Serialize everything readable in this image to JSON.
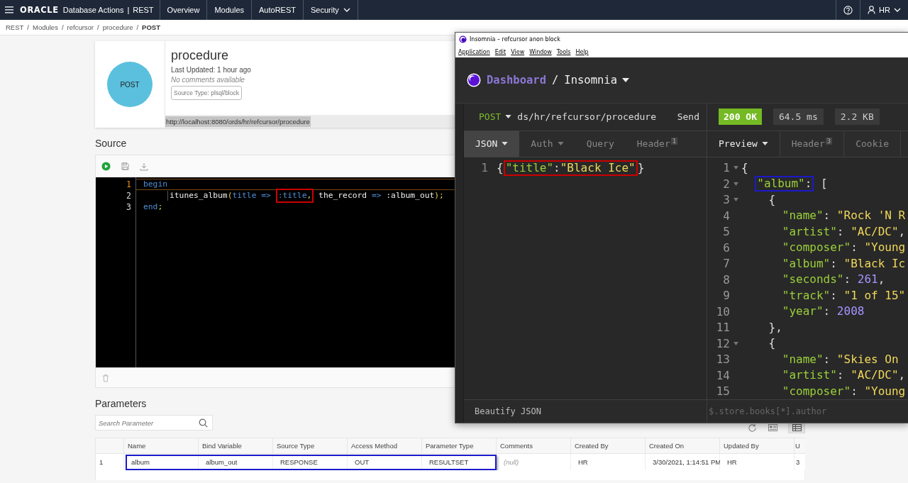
{
  "topbar": {
    "brand": "ORACLE",
    "product": "Database Actions",
    "divider": "|",
    "section": "REST",
    "user": "HR",
    "nav": [
      {
        "label": "Overview",
        "selected": false,
        "menu": false
      },
      {
        "label": "Modules",
        "selected": false,
        "menu": false
      },
      {
        "label": "AutoREST",
        "selected": false,
        "menu": false
      },
      {
        "label": "Security",
        "selected": false,
        "menu": true
      }
    ]
  },
  "breadcrumb": [
    {
      "label": "REST",
      "current": false
    },
    {
      "separator": "/",
      "label": "Modules",
      "current": false
    },
    {
      "separator": "/",
      "label": "refcursor",
      "current": false
    },
    {
      "separator": "/",
      "label": "procedure",
      "current": false
    },
    {
      "separator": "/",
      "label": "POST",
      "current": true
    }
  ],
  "handler": {
    "method": "POST",
    "title": "procedure",
    "updated": "Last Updated: 1 hour ago",
    "comments": "No comments available",
    "source_type": "Source Type: plsql/block",
    "url": "http://localhost:8080/ords/hr/refcursor/procedure"
  },
  "source": {
    "heading": "Source",
    "lines": [
      {
        "number": "1",
        "active": true,
        "tokens": [
          {
            "text": "begin",
            "kind": "keyword"
          }
        ]
      },
      {
        "number": "2",
        "active": false,
        "tokens": [
          {
            "text": "itunes_album",
            "kind": "ident"
          },
          {
            "text": "(",
            "kind": "paren"
          },
          {
            "text": "title =>",
            "kind": "keyword"
          },
          {
            "kind": "group",
            "color": "#cc0000",
            "gap": true,
            "parts": [
              {
                "text": ":title",
                "kind": "keyword"
              },
              {
                "text": ",",
                "kind": "paren"
              }
            ]
          },
          {
            "text": "the_record",
            "kind": "ident",
            "gap": true
          },
          {
            "text": "=>",
            "kind": "keyword",
            "gap": true
          },
          {
            "text": ":album_out",
            "kind": "ident",
            "gap": true
          },
          {
            "text": ");",
            "kind": "paren"
          }
        ]
      },
      {
        "number": "3",
        "active": false,
        "tokens": [
          {
            "text": "end",
            "kind": "keyword"
          },
          {
            "text": ";",
            "kind": "paren"
          }
        ]
      }
    ]
  },
  "parameters": {
    "heading": "Parameters",
    "search": {
      "placeholder": "Search Parameter"
    },
    "views": [
      {
        "kind": "card",
        "selected": false
      },
      {
        "kind": "table",
        "selected": true
      }
    ],
    "columns": [
      "Name",
      "Bind Variable",
      "Source Type",
      "Access Method",
      "Parameter Type",
      "Comments",
      "Created By",
      "Created On",
      "Updated By",
      "U"
    ],
    "rows": [
      {
        "index": "1",
        "color": "#1a1acc",
        "cells": [
          {
            "text": "album",
            "outlined": true,
            "muted": false
          },
          {
            "text": "album_out",
            "outlined": true,
            "muted": false
          },
          {
            "text": "RESPONSE",
            "outlined": true,
            "muted": false
          },
          {
            "text": "OUT",
            "outlined": true,
            "muted": false
          },
          {
            "text": "RESULTSET",
            "outlined": true,
            "muted": false
          },
          {
            "text": "(null)",
            "outlined": false,
            "muted": true
          },
          {
            "text": "HR",
            "outlined": false,
            "muted": false
          },
          {
            "text": "3/30/2021, 1:14:51 PM",
            "outlined": false,
            "muted": false
          },
          {
            "text": "HR",
            "outlined": false,
            "muted": false
          },
          {
            "text": "3",
            "outlined": false,
            "muted": false
          }
        ]
      }
    ]
  },
  "insomnia": {
    "window": {
      "title": "Insomnia – refcursor anon block"
    },
    "menu": [
      "Application",
      "Edit",
      "View",
      "Window",
      "Tools",
      "Help"
    ],
    "header": {
      "dashboard": "Dashboard",
      "separator": "/",
      "workspace": "Insomnia"
    },
    "request": {
      "method": "POST",
      "url": "ds/hr/refcursor/procedure",
      "send": "Send"
    },
    "response": {
      "status": "200 OK",
      "time": "64.5 ms",
      "size": "2.2 KB"
    },
    "request_tabs": [
      {
        "label": "JSON",
        "selected": true,
        "dropdown": true
      },
      {
        "label": "Auth",
        "selected": false,
        "dropdown": true
      },
      {
        "label": "Query",
        "selected": false,
        "dropdown": false
      },
      {
        "label": "Header",
        "selected": false,
        "dropdown": false,
        "badge": "1"
      }
    ],
    "response_tabs": [
      {
        "label": "Preview",
        "selected": true,
        "dropdown": true
      },
      {
        "label": "Header",
        "selected": false,
        "dropdown": false,
        "badge": "3"
      },
      {
        "label": "Cookie",
        "selected": false,
        "dropdown": false
      }
    ],
    "body_lines": [
      {
        "number": "1",
        "fold": false,
        "tokens": [
          {
            "text": "{",
            "kind": "punct"
          },
          {
            "kind": "group",
            "color": "#cc0000",
            "parts": [
              {
                "text": "\"title\"",
                "kind": "key"
              },
              {
                "text": ":",
                "kind": "punct"
              },
              {
                "text": "\"Black Ice\"",
                "kind": "string"
              }
            ]
          },
          {
            "text": "}",
            "kind": "punct"
          }
        ]
      }
    ],
    "preview_lines": [
      {
        "number": "1",
        "fold": true,
        "tokens": [
          {
            "text": "{",
            "kind": "punct"
          }
        ],
        "children": [
          {
            "number": "2",
            "fold": true,
            "tokens": [
              {
                "kind": "group",
                "color": "#1a1acc",
                "parts": [
                  {
                    "text": "\"album\"",
                    "kind": "key"
                  },
                  {
                    "text": ":",
                    "kind": "punct"
                  }
                ]
              },
              {
                "text": "[",
                "kind": "punct",
                "gap": true
              }
            ],
            "children": [
              {
                "number": "3",
                "fold": true,
                "tokens": [
                  {
                    "text": "{",
                    "kind": "punct"
                  }
                ],
                "children": [
                  {
                    "number": "4",
                    "fold": false,
                    "tokens": [
                      {
                        "text": "\"name\"",
                        "kind": "key"
                      },
                      {
                        "text": ":",
                        "kind": "punct"
                      },
                      {
                        "text": "\"Rock 'N R",
                        "kind": "string",
                        "gap": true
                      }
                    ]
                  },
                  {
                    "number": "5",
                    "fold": false,
                    "tokens": [
                      {
                        "text": "\"artist\"",
                        "kind": "key"
                      },
                      {
                        "text": ":",
                        "kind": "punct"
                      },
                      {
                        "text": "\"AC/DC\"",
                        "kind": "string",
                        "gap": true
                      },
                      {
                        "text": ",",
                        "kind": "punct"
                      }
                    ]
                  },
                  {
                    "number": "6",
                    "fold": false,
                    "tokens": [
                      {
                        "text": "\"composer\"",
                        "kind": "key"
                      },
                      {
                        "text": ":",
                        "kind": "punct"
                      },
                      {
                        "text": "\"Young",
                        "kind": "string",
                        "gap": true
                      }
                    ]
                  },
                  {
                    "number": "7",
                    "fold": false,
                    "tokens": [
                      {
                        "text": "\"album\"",
                        "kind": "key"
                      },
                      {
                        "text": ":",
                        "kind": "punct"
                      },
                      {
                        "text": "\"Black Ic",
                        "kind": "string",
                        "gap": true
                      }
                    ]
                  },
                  {
                    "number": "8",
                    "fold": false,
                    "tokens": [
                      {
                        "text": "\"seconds\"",
                        "kind": "key"
                      },
                      {
                        "text": ":",
                        "kind": "punct"
                      },
                      {
                        "text": "261",
                        "kind": "number",
                        "gap": true
                      },
                      {
                        "text": ",",
                        "kind": "punct"
                      }
                    ]
                  },
                  {
                    "number": "9",
                    "fold": false,
                    "tokens": [
                      {
                        "text": "\"track\"",
                        "kind": "key"
                      },
                      {
                        "text": ":",
                        "kind": "punct"
                      },
                      {
                        "text": "\"1 of 15\"",
                        "kind": "string",
                        "gap": true
                      }
                    ]
                  },
                  {
                    "number": "10",
                    "fold": false,
                    "tokens": [
                      {
                        "text": "\"year\"",
                        "kind": "key"
                      },
                      {
                        "text": ":",
                        "kind": "punct"
                      },
                      {
                        "text": "2008",
                        "kind": "number",
                        "gap": true
                      }
                    ]
                  }
                ]
              },
              {
                "number": "11",
                "fold": false,
                "tokens": [
                  {
                    "text": "},",
                    "kind": "punct"
                  }
                ]
              },
              {
                "number": "12",
                "fold": true,
                "tokens": [
                  {
                    "text": "{",
                    "kind": "punct"
                  }
                ],
                "children": [
                  {
                    "number": "13",
                    "fold": false,
                    "tokens": [
                      {
                        "text": "\"name\"",
                        "kind": "key"
                      },
                      {
                        "text": ":",
                        "kind": "punct"
                      },
                      {
                        "text": "\"Skies On",
                        "kind": "string",
                        "gap": true
                      }
                    ]
                  },
                  {
                    "number": "14",
                    "fold": false,
                    "tokens": [
                      {
                        "text": "\"artist\"",
                        "kind": "key"
                      },
                      {
                        "text": ":",
                        "kind": "punct"
                      },
                      {
                        "text": "\"AC/DC\"",
                        "kind": "string",
                        "gap": true
                      },
                      {
                        "text": ",",
                        "kind": "punct"
                      }
                    ]
                  },
                  {
                    "number": "15",
                    "fold": false,
                    "tokens": [
                      {
                        "text": "\"composer\"",
                        "kind": "key"
                      },
                      {
                        "text": ":",
                        "kind": "punct"
                      },
                      {
                        "text": "\"Young",
                        "kind": "string",
                        "gap": true
                      }
                    ]
                  }
                ]
              }
            ]
          }
        ]
      }
    ],
    "footer": {
      "left": "Beautify JSON",
      "filter_placeholder": "$.store.books[*].author"
    }
  }
}
